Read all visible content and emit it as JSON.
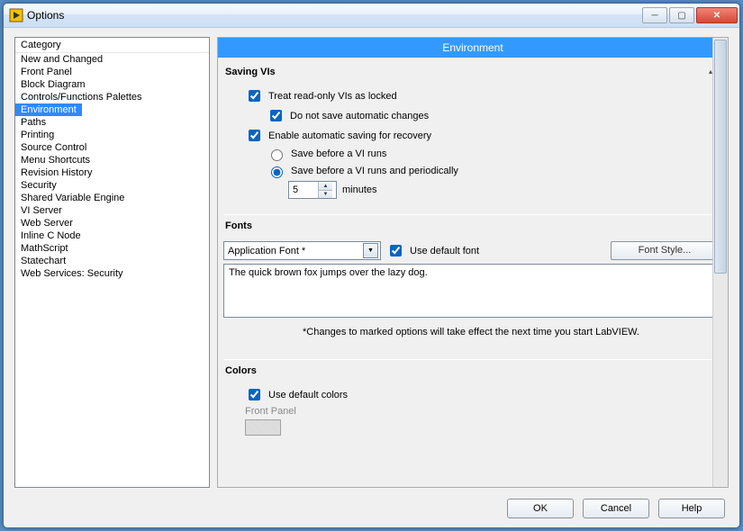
{
  "window": {
    "title": "Options"
  },
  "category": {
    "header": "Category",
    "items": [
      "New and Changed",
      "Front Panel",
      "Block Diagram",
      "Controls/Functions Palettes",
      "Environment",
      "Paths",
      "Printing",
      "Source Control",
      "Menu Shortcuts",
      "Revision History",
      "Security",
      "Shared Variable Engine",
      "VI Server",
      "Web Server",
      "Inline C Node",
      "MathScript",
      "Statechart",
      "Web Services: Security"
    ],
    "selected_index": 4
  },
  "banner": "Environment",
  "saving": {
    "title": "Saving VIs",
    "treat_readonly": {
      "label": "Treat read-only VIs as locked",
      "checked": true
    },
    "dont_save_auto": {
      "label": "Do not save automatic changes",
      "checked": true
    },
    "enable_recovery": {
      "label": "Enable automatic saving for recovery",
      "checked": true
    },
    "save_before_run": {
      "label": "Save before a VI runs",
      "selected": false
    },
    "save_periodic": {
      "label": "Save before a VI runs and periodically",
      "selected": true
    },
    "minutes_value": "5",
    "minutes_unit": "minutes"
  },
  "fonts": {
    "title": "Fonts",
    "combo_value": "Application Font *",
    "use_default": {
      "label": "Use default font",
      "checked": true
    },
    "font_style_btn": "Font Style...",
    "preview": "The quick brown fox jumps over the lazy dog.",
    "note": "*Changes to marked options will take effect the next time you start LabVIEW."
  },
  "colors": {
    "title": "Colors",
    "use_default": {
      "label": "Use default colors",
      "checked": true
    },
    "front_panel_label": "Front Panel"
  },
  "buttons": {
    "ok": "OK",
    "cancel": "Cancel",
    "help": "Help"
  }
}
